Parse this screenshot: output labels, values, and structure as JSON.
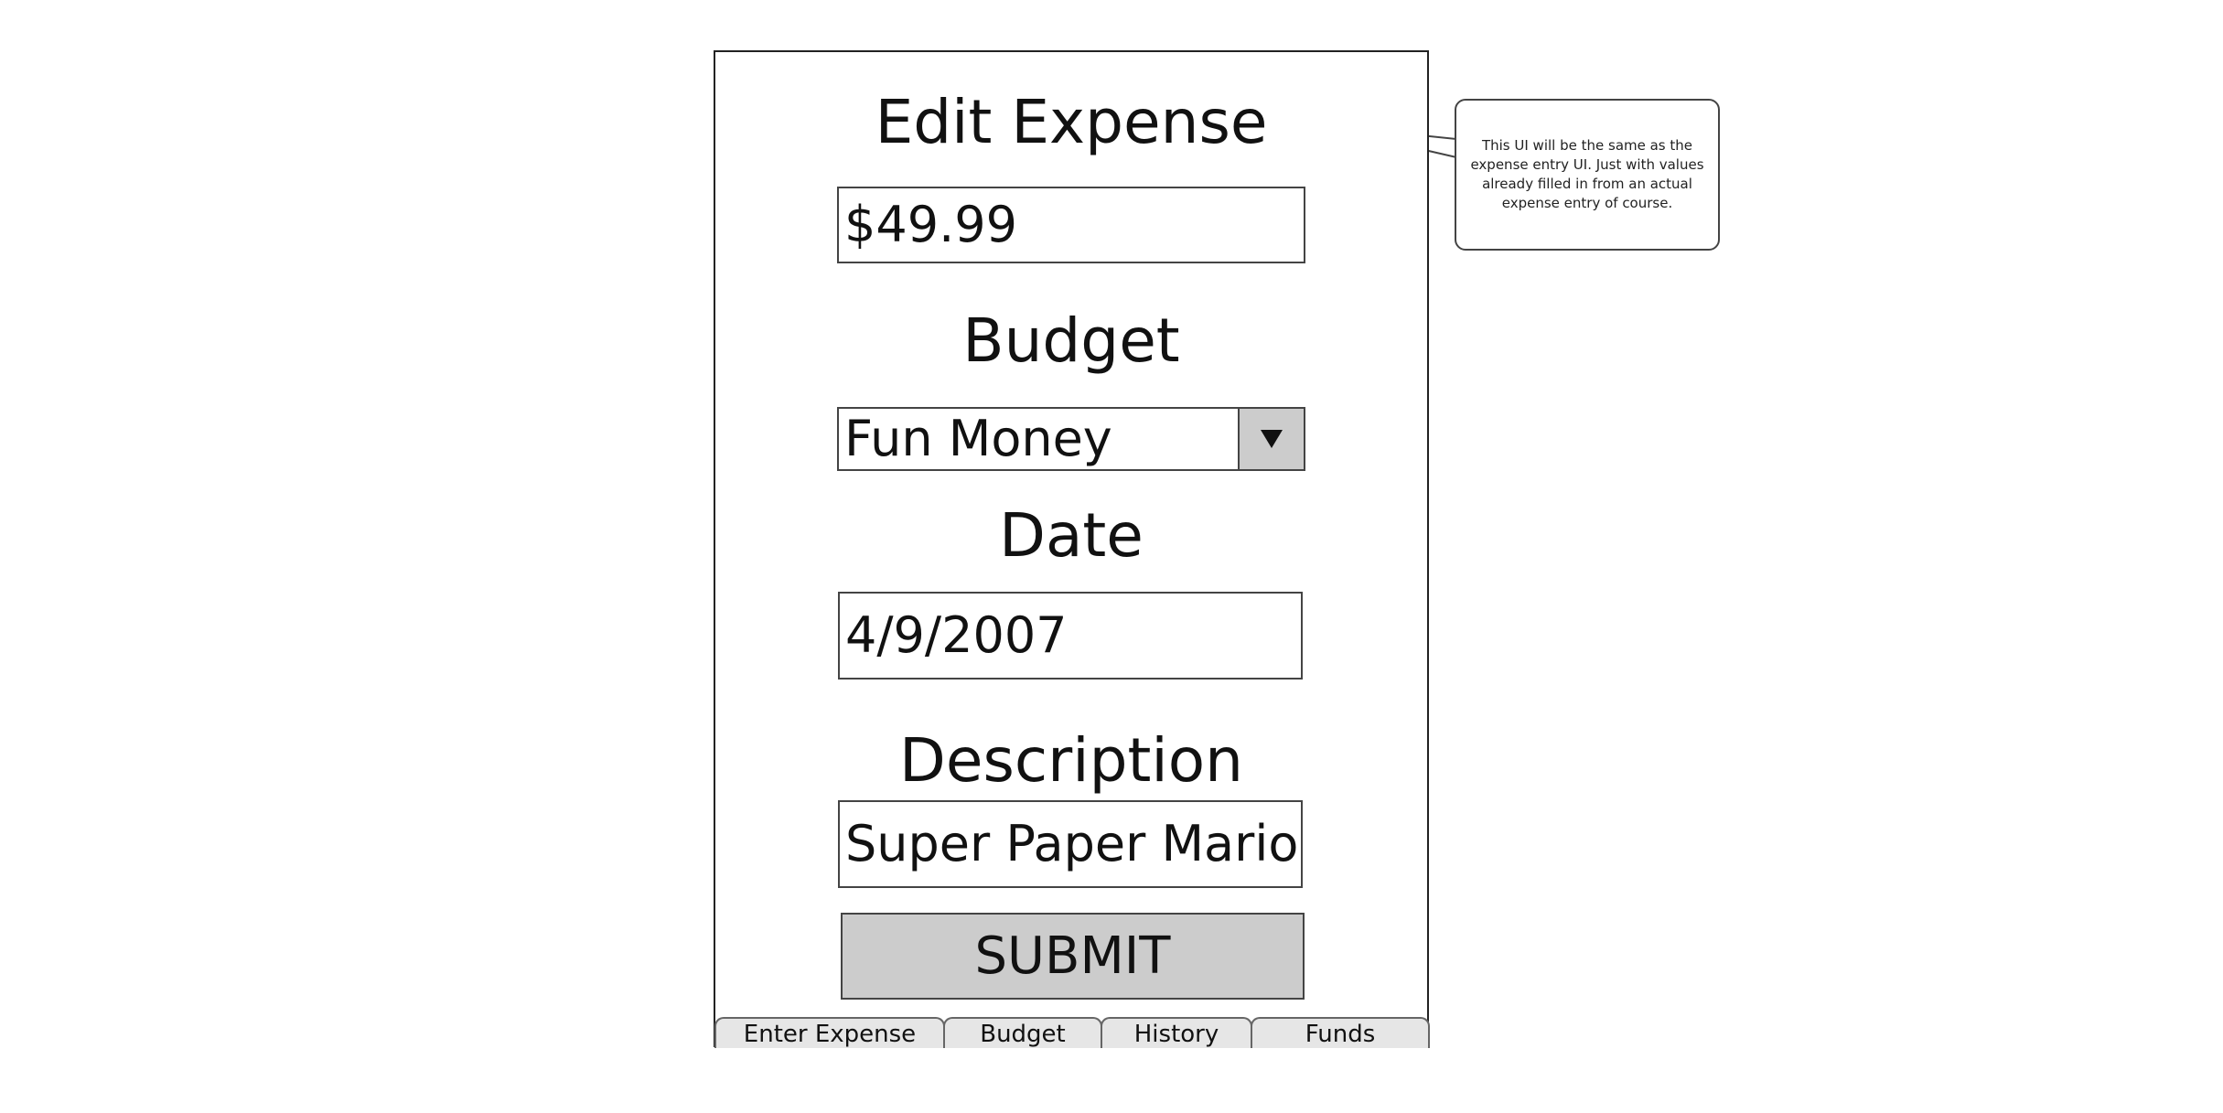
{
  "screen": {
    "title": "Edit Expense",
    "amount_value": "$49.99",
    "budget_label": "Budget",
    "budget_selected": "Fun Money",
    "budget_arrow_icon": "dropdown-triangle-icon",
    "date_label": "Date",
    "date_value": "4/9/2007",
    "description_label": "Description",
    "description_value": "Super Paper Mario",
    "submit_label": "SUBMIT"
  },
  "tabs": [
    {
      "label": "Enter Expense"
    },
    {
      "label": "Budget"
    },
    {
      "label": "History"
    },
    {
      "label": "Funds"
    }
  ],
  "annotation": {
    "text": "This UI will be the same as the\nexpense entry UI. Just with values\nalready filled in from an actual\nexpense entry of course."
  },
  "colors": {
    "border": "#444444",
    "button_fill": "#cccccc",
    "tab_fill": "#e6e6e6"
  }
}
